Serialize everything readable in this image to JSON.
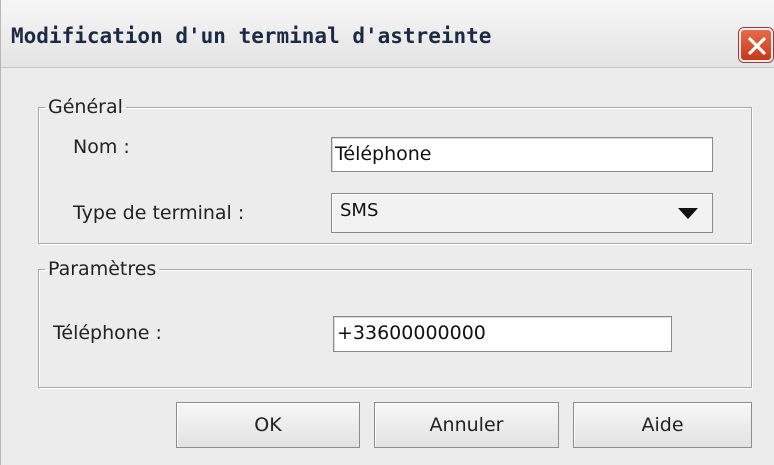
{
  "window": {
    "title": "Modification d'un terminal d'astreinte",
    "close_icon": "close-icon"
  },
  "general": {
    "legend": "Général",
    "name_label": "Nom :",
    "name_value": "Téléphone",
    "type_label": "Type de terminal :",
    "type_value": "SMS"
  },
  "parameters": {
    "legend": "Paramètres",
    "phone_label": "Téléphone :",
    "phone_value": "+33600000000"
  },
  "buttons": {
    "ok": "OK",
    "cancel": "Annuler",
    "help": "Aide"
  },
  "colors": {
    "close_button": "#d2502e",
    "title_text": "#1e2a44"
  }
}
